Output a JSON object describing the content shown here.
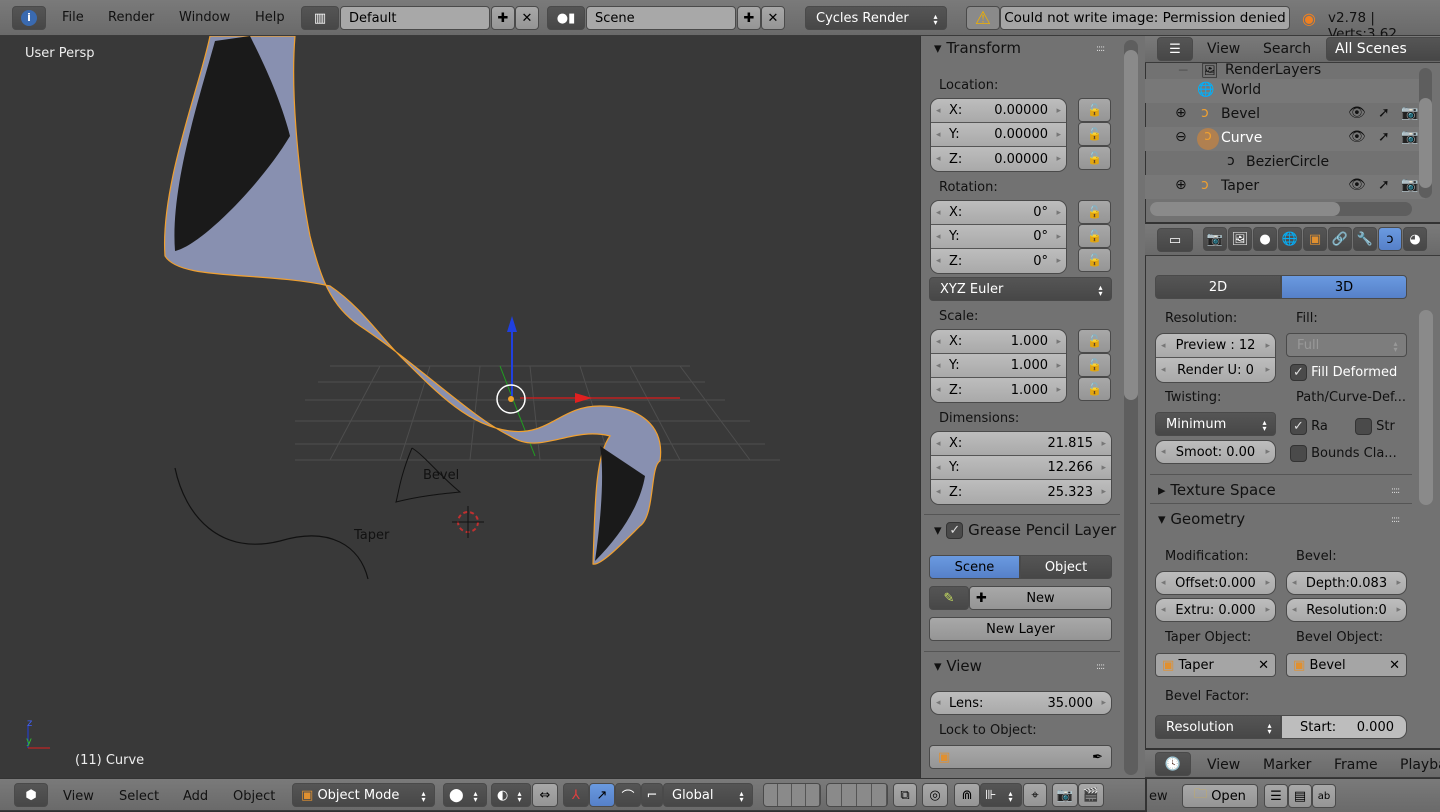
{
  "topbar": {
    "menus": [
      "File",
      "Render",
      "Window",
      "Help"
    ],
    "layout": "Default",
    "scene": "Scene",
    "engine": "Cycles Render",
    "warning": "Could not write image: Permission denied",
    "version": "v2.78 | Verts:3,62"
  },
  "viewport": {
    "view_label": "User Persp",
    "object_label": "(11) Curve",
    "bevel_label": "Bevel",
    "taper_label": "Taper",
    "colors": {
      "bg": "#393939",
      "selected": "#f0a030",
      "mesh": "#8890b0"
    }
  },
  "npanel": {
    "transform": "Transform",
    "location": "Location:",
    "rotation": "Rotation:",
    "scale": "Scale:",
    "dimensions": "Dimensions:",
    "loc": [
      [
        "X:",
        "0.00000"
      ],
      [
        "Y:",
        "0.00000"
      ],
      [
        "Z:",
        "0.00000"
      ]
    ],
    "rot": [
      [
        "X:",
        "0°"
      ],
      [
        "Y:",
        "0°"
      ],
      [
        "Z:",
        "0°"
      ]
    ],
    "rot_mode": "XYZ Euler",
    "scl": [
      [
        "X:",
        "1.000"
      ],
      [
        "Y:",
        "1.000"
      ],
      [
        "Z:",
        "1.000"
      ]
    ],
    "dim": [
      [
        "X:",
        "21.815"
      ],
      [
        "Y:",
        "12.266"
      ],
      [
        "Z:",
        "25.323"
      ]
    ],
    "gp_header": "Grease Pencil Layer",
    "gp_scene": "Scene",
    "gp_object": "Object",
    "gp_new": "New",
    "gp_new_layer": "New Layer",
    "view": "View",
    "lens_label": "Lens:",
    "lens": "35.000",
    "lock_label": "Lock to Object:"
  },
  "outliner": {
    "view": "View",
    "search": "Search",
    "scenes": "All Scenes",
    "items": [
      "RenderLayers",
      "World",
      "Bevel",
      "Curve",
      "BezierCircle",
      "Taper"
    ]
  },
  "props": {
    "d2": "2D",
    "d3": "3D",
    "resolution": "Resolution:",
    "preview": "Preview : 12",
    "render_u": "Render U: 0",
    "fill": "Fill:",
    "fill_val": "Full",
    "fill_deformed": "Fill Deformed",
    "twisting": "Twisting:",
    "twist_val": "Minimum",
    "smooth": "Smoot: 0.00",
    "path": "Path/Curve-Def...",
    "ra": "Ra",
    "str": "Str",
    "bounds": "Bounds Cla...",
    "texture_space": "Texture Space",
    "geometry": "Geometry",
    "modification": "Modification:",
    "bevel": "Bevel:",
    "offset": "Offset:0.000",
    "depth": "Depth:0.083",
    "extru": "Extru: 0.000",
    "bres": "Resolution:0",
    "taper_obj": "Taper Object:",
    "bevel_obj": "Bevel Object:",
    "taper": "Taper",
    "bevel_name": "Bevel",
    "bevel_factor": "Bevel Factor:",
    "bf_mode": "Resolution",
    "start": "Start:",
    "start_val": "0.000"
  },
  "timeline": {
    "menus": [
      "View",
      "Marker",
      "Frame",
      "Playba"
    ]
  },
  "bottombar": {
    "menus": [
      "View",
      "Select",
      "Add",
      "Object"
    ],
    "mode": "Object Mode",
    "orientation": "Global",
    "fb_ew": "ew",
    "open": "Open"
  }
}
